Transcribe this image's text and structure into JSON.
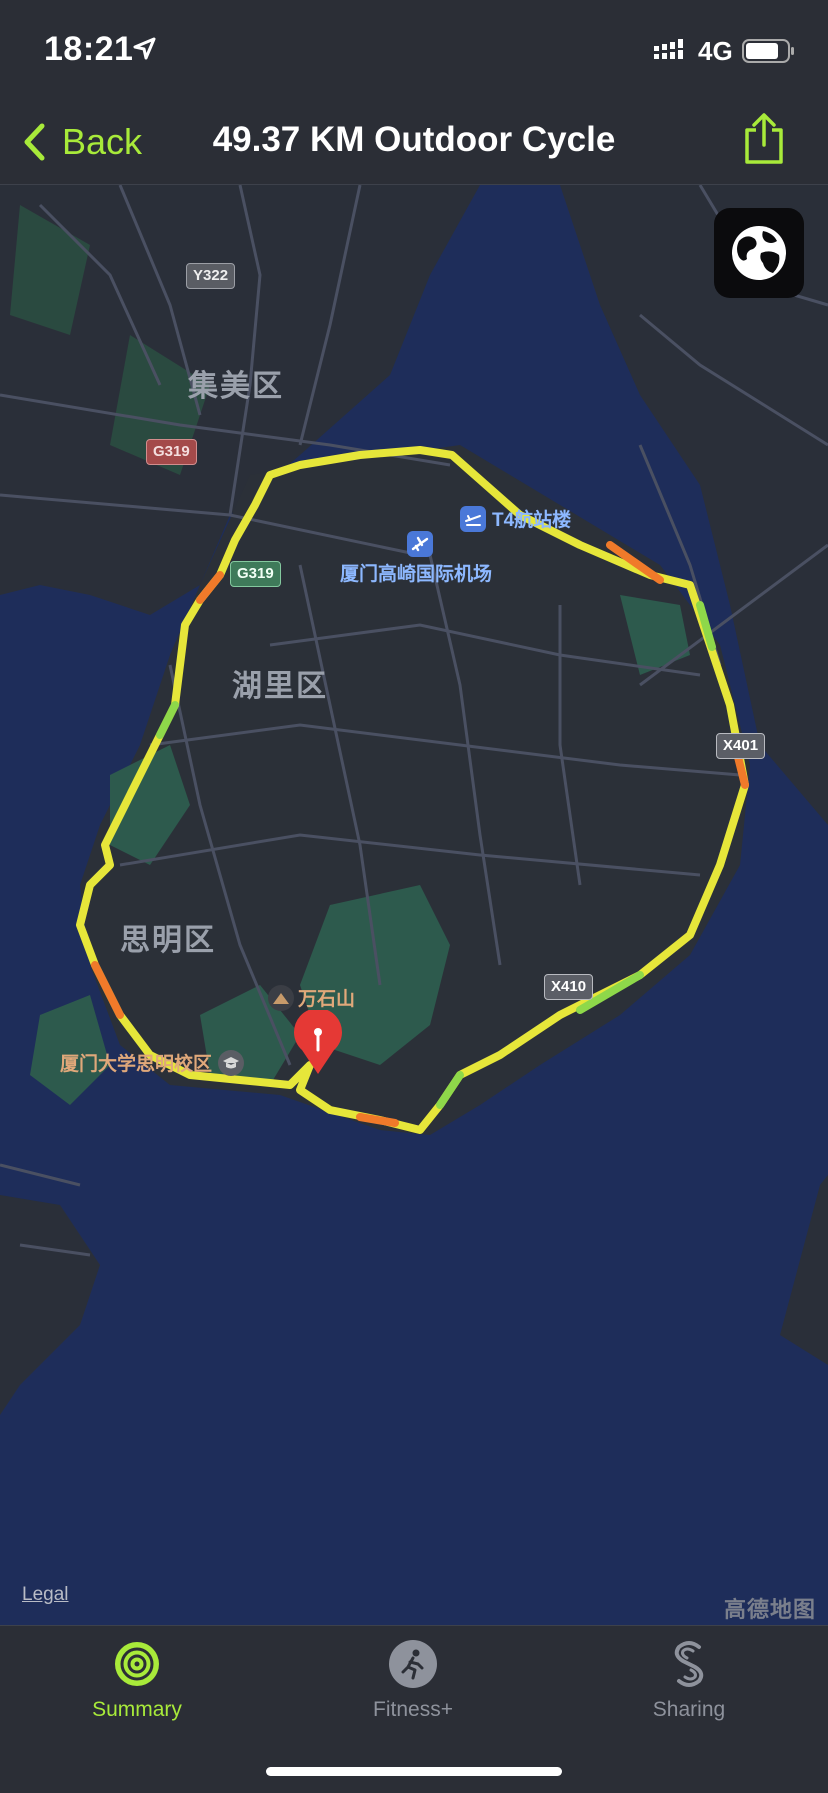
{
  "status_bar": {
    "time": "18:21",
    "network": "4G",
    "icons": [
      "location-arrow-icon",
      "signal-icon",
      "battery-icon"
    ]
  },
  "nav": {
    "back_label": "Back",
    "title": "49.37 KM Outdoor Cycle",
    "share_icon": "share-icon",
    "accent_color": "#a8ea3a"
  },
  "map": {
    "globe_icon": "globe-icon",
    "districts": {
      "jimei": "集美区",
      "huli": "湖里区",
      "siming": "思明区"
    },
    "roads": {
      "y322": "Y322",
      "g319_a": "G319",
      "g319_b": "G319",
      "x401": "X401",
      "x410": "X410"
    },
    "pois": {
      "t4_terminal": "T4航站楼",
      "airport": "厦门高崎国际机场",
      "wanshi_mountain": "万石山",
      "xmu_siming": "厦门大学思明校区"
    },
    "legal": "Legal",
    "credit": "高德地图",
    "route_colors": [
      "#e6e63a",
      "#f07a2a",
      "#8ed84a"
    ]
  },
  "tabs": {
    "summary": "Summary",
    "fitness": "Fitness+",
    "sharing": "Sharing",
    "active": "summary"
  }
}
